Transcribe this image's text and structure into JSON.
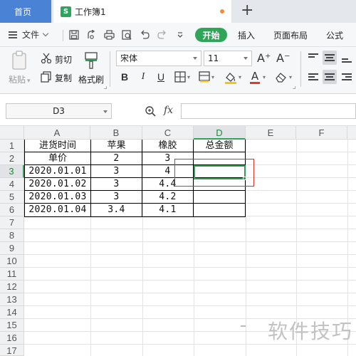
{
  "tabs": {
    "home_label": "首页",
    "doc_icon_letter": "S",
    "doc_label": "工作簿1",
    "add_tab": "+"
  },
  "menu": {
    "file_label": "文件",
    "start_label": "开始",
    "insert_label": "插入",
    "page_layout_label": "页面布局",
    "formula_label": "公式"
  },
  "ribbon": {
    "paste_label": "粘贴",
    "cut_label": "剪切",
    "copy_label": "复制",
    "format_painter_label": "格式刷",
    "font_name": "宋体",
    "font_size": "11",
    "bold": "B",
    "italic": "I",
    "underline": "U",
    "font_color_letter": "A",
    "grow_font": "A⁺",
    "shrink_font": "A⁻"
  },
  "formula_bar": {
    "name_box": "D3",
    "fx_label": "fx",
    "formula_value": ""
  },
  "sheet": {
    "columns": [
      "A",
      "B",
      "C",
      "D",
      "E",
      "F"
    ],
    "active_column": "D",
    "rows": [
      "1",
      "2",
      "3",
      "4",
      "5",
      "6",
      "7",
      "8",
      "9",
      "10",
      "11",
      "12",
      "13",
      "14",
      "15",
      "16",
      "17"
    ],
    "active_row": "3",
    "cells": {
      "A1": "进货时间",
      "B1": "苹果",
      "C1": "橡胶",
      "D1": "总金额",
      "A2": "单价",
      "B2": "2",
      "C2": "3",
      "A3": "2020.01.01",
      "B3": "3",
      "C3": "4",
      "A4": "2020.01.02",
      "B4": "3",
      "C4": "4.4",
      "A5": "2020.01.03",
      "B5": "3",
      "C5": "4.2",
      "A6": "2020.01.04",
      "B6": "3.4",
      "C6": "4.1"
    },
    "selected_cell": "D3"
  },
  "watermark": "软件技巧",
  "colors": {
    "accent_green": "#30a55a",
    "home_tab_blue": "#4a82d6",
    "highlight_red": "#d9342b"
  }
}
